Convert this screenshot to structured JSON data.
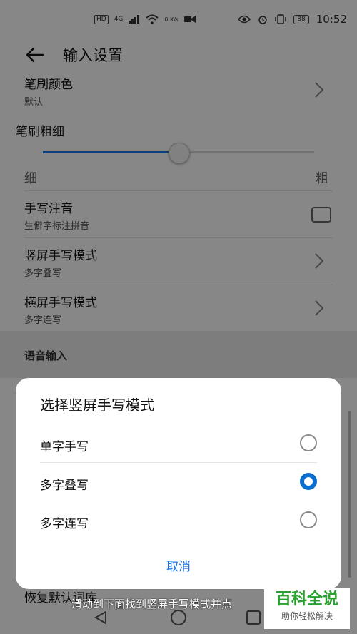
{
  "status_bar": {
    "left_chip": "HD",
    "signal_text": "4G",
    "speed": "0 K/s",
    "battery": "88",
    "time": "10:52"
  },
  "app_bar": {
    "title": "输入设置"
  },
  "settings": {
    "brush_color": {
      "title": "笔刷颜色",
      "subtitle": "默认"
    },
    "brush_thickness": {
      "title": "笔刷粗细",
      "min_label": "细",
      "max_label": "粗",
      "value_fraction": 0.5
    },
    "handwriting_pinyin": {
      "title": "手写注音",
      "subtitle": "生僻字标注拼音",
      "checked": false
    },
    "portrait_mode": {
      "title": "竖屏手写模式",
      "subtitle": "多字叠写"
    },
    "landscape_mode": {
      "title": "横屏手写模式",
      "subtitle": "多字连写"
    },
    "voice_section": {
      "label": "语音输入"
    },
    "restore": {
      "title": "恢复默认词库"
    }
  },
  "dialog": {
    "title": "选择竖屏手写模式",
    "options": [
      {
        "label": "单字手写",
        "selected": false
      },
      {
        "label": "多字叠写",
        "selected": true
      },
      {
        "label": "多字连写",
        "selected": false
      }
    ],
    "cancel_label": "取消"
  },
  "caption": "滑动到下面找到竖屏手写模式并点",
  "watermark": {
    "main": "百科全说",
    "sub": "助你轻松解决"
  },
  "colors": {
    "accent": "#1a73e8",
    "radio_selected": "#0a6ed1",
    "watermark_green": "#2aa12e"
  }
}
